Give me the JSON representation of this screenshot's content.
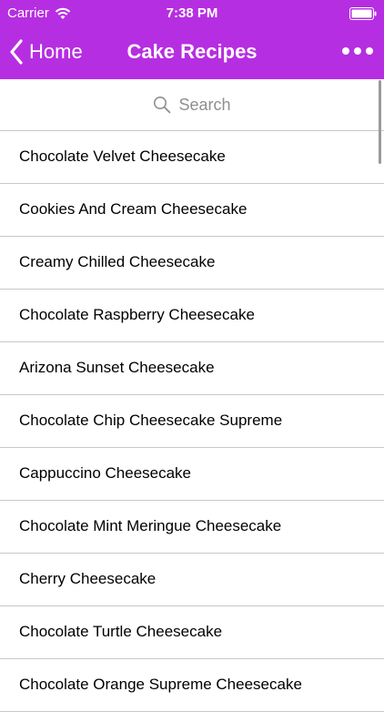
{
  "status_bar": {
    "carrier": "Carrier",
    "time": "7:38 PM"
  },
  "nav_bar": {
    "back_label": "Home",
    "title": "Cake Recipes",
    "accent_color": "#b62ee1"
  },
  "search": {
    "placeholder": "Search"
  },
  "recipes": [
    {
      "label": "Chocolate Velvet Cheesecake"
    },
    {
      "label": "Cookies And Cream Cheesecake"
    },
    {
      "label": "Creamy Chilled Cheesecake"
    },
    {
      "label": "Chocolate Raspberry Cheesecake"
    },
    {
      "label": "Arizona Sunset Cheesecake"
    },
    {
      "label": "Chocolate Chip Cheesecake Supreme"
    },
    {
      "label": "Cappuccino Cheesecake"
    },
    {
      "label": "Chocolate Mint Meringue Cheesecake"
    },
    {
      "label": "Cherry Cheesecake"
    },
    {
      "label": "Chocolate Turtle Cheesecake"
    },
    {
      "label": "Chocolate Orange Supreme Cheesecake"
    }
  ]
}
